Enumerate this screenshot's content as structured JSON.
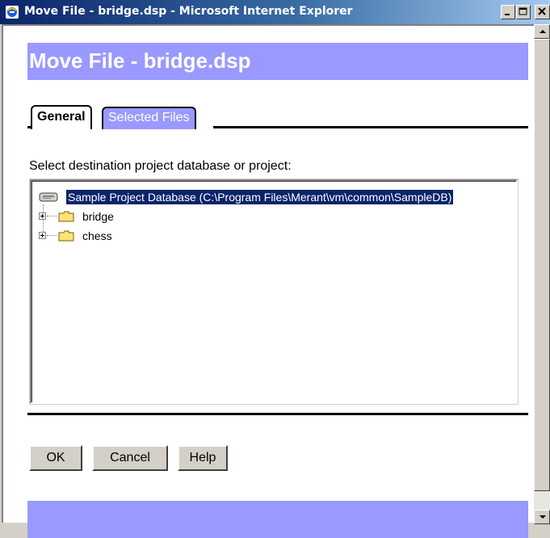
{
  "window": {
    "title": "Move File - bridge.dsp - Microsoft Internet Explorer",
    "minimize_label": "_",
    "maximize_label": "□",
    "close_label": "X"
  },
  "page": {
    "header_title": "Move File - bridge.dsp",
    "tabs": [
      {
        "label": "General"
      },
      {
        "label": "Selected Files"
      }
    ],
    "instruction": "Select destination project database or project:",
    "tree": {
      "root": {
        "label": "Sample Project Database (C:\\Program Files\\Merant\\vm\\common\\SampleDB)"
      },
      "children": [
        {
          "label": "bridge"
        },
        {
          "label": "chess"
        }
      ]
    },
    "buttons": {
      "ok": "OK",
      "cancel": "Cancel",
      "help": "Help"
    }
  },
  "colors": {
    "accent_band": "#9999ff",
    "selection": "#0a246a",
    "titlebar_start": "#0a246a"
  },
  "icons": {
    "title_icon": "ie-icon",
    "root_icon": "database-icon",
    "child_icon": "folder-icon",
    "expander_icon": "plus-box-icon"
  }
}
